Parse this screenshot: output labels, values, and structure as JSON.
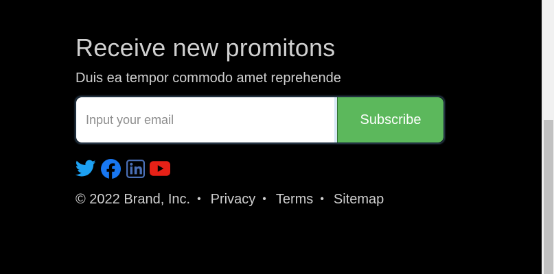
{
  "newsletter": {
    "title": "Receive new promitons",
    "subtitle": "Duis ea tempor commodo amet reprehende",
    "email_placeholder": "Input your email",
    "subscribe_label": "Subscribe"
  },
  "social": [
    {
      "name": "twitter",
      "icon": "twitter-icon",
      "color": "#1da1f2"
    },
    {
      "name": "facebook",
      "icon": "facebook-icon",
      "color": "#1877f2"
    },
    {
      "name": "linkedin",
      "icon": "linkedin-icon",
      "color": "#4a6fb5"
    },
    {
      "name": "youtube",
      "icon": "youtube-icon",
      "color": "#e62117"
    }
  ],
  "footer": {
    "copyright": "© 2022 Brand, Inc.",
    "separator": "•",
    "links": [
      "Privacy",
      "Terms",
      "Sitemap"
    ]
  },
  "colors": {
    "background": "#000000",
    "text": "#cfcfcf",
    "button": "#5cb85c"
  }
}
